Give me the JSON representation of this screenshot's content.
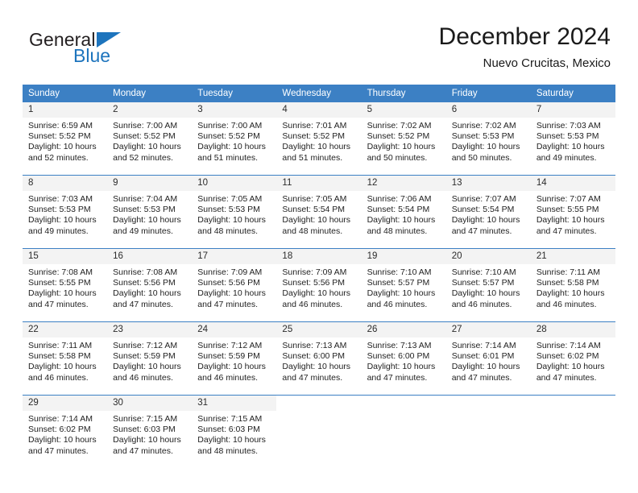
{
  "brand": {
    "line1": "General",
    "line2": "Blue",
    "triangle_color": "#1d74bd"
  },
  "header": {
    "title": "December 2024",
    "location": "Nuevo Crucitas, Mexico"
  },
  "theme": {
    "header_blue": "#3c80c4",
    "daynum_band": "#f3f3f3",
    "text": "#222222"
  },
  "weekday_headers": [
    "Sunday",
    "Monday",
    "Tuesday",
    "Wednesday",
    "Thursday",
    "Friday",
    "Saturday"
  ],
  "labels": {
    "sunrise_prefix": "Sunrise: ",
    "sunset_prefix": "Sunset: ",
    "daylight_prefix": "Daylight: "
  },
  "weeks": [
    [
      {
        "day": "1",
        "sunrise": "Sunrise: 6:59 AM",
        "sunset": "Sunset: 5:52 PM",
        "daylight1": "Daylight: 10 hours",
        "daylight2": "and 52 minutes."
      },
      {
        "day": "2",
        "sunrise": "Sunrise: 7:00 AM",
        "sunset": "Sunset: 5:52 PM",
        "daylight1": "Daylight: 10 hours",
        "daylight2": "and 52 minutes."
      },
      {
        "day": "3",
        "sunrise": "Sunrise: 7:00 AM",
        "sunset": "Sunset: 5:52 PM",
        "daylight1": "Daylight: 10 hours",
        "daylight2": "and 51 minutes."
      },
      {
        "day": "4",
        "sunrise": "Sunrise: 7:01 AM",
        "sunset": "Sunset: 5:52 PM",
        "daylight1": "Daylight: 10 hours",
        "daylight2": "and 51 minutes."
      },
      {
        "day": "5",
        "sunrise": "Sunrise: 7:02 AM",
        "sunset": "Sunset: 5:52 PM",
        "daylight1": "Daylight: 10 hours",
        "daylight2": "and 50 minutes."
      },
      {
        "day": "6",
        "sunrise": "Sunrise: 7:02 AM",
        "sunset": "Sunset: 5:53 PM",
        "daylight1": "Daylight: 10 hours",
        "daylight2": "and 50 minutes."
      },
      {
        "day": "7",
        "sunrise": "Sunrise: 7:03 AM",
        "sunset": "Sunset: 5:53 PM",
        "daylight1": "Daylight: 10 hours",
        "daylight2": "and 49 minutes."
      }
    ],
    [
      {
        "day": "8",
        "sunrise": "Sunrise: 7:03 AM",
        "sunset": "Sunset: 5:53 PM",
        "daylight1": "Daylight: 10 hours",
        "daylight2": "and 49 minutes."
      },
      {
        "day": "9",
        "sunrise": "Sunrise: 7:04 AM",
        "sunset": "Sunset: 5:53 PM",
        "daylight1": "Daylight: 10 hours",
        "daylight2": "and 49 minutes."
      },
      {
        "day": "10",
        "sunrise": "Sunrise: 7:05 AM",
        "sunset": "Sunset: 5:53 PM",
        "daylight1": "Daylight: 10 hours",
        "daylight2": "and 48 minutes."
      },
      {
        "day": "11",
        "sunrise": "Sunrise: 7:05 AM",
        "sunset": "Sunset: 5:54 PM",
        "daylight1": "Daylight: 10 hours",
        "daylight2": "and 48 minutes."
      },
      {
        "day": "12",
        "sunrise": "Sunrise: 7:06 AM",
        "sunset": "Sunset: 5:54 PM",
        "daylight1": "Daylight: 10 hours",
        "daylight2": "and 48 minutes."
      },
      {
        "day": "13",
        "sunrise": "Sunrise: 7:07 AM",
        "sunset": "Sunset: 5:54 PM",
        "daylight1": "Daylight: 10 hours",
        "daylight2": "and 47 minutes."
      },
      {
        "day": "14",
        "sunrise": "Sunrise: 7:07 AM",
        "sunset": "Sunset: 5:55 PM",
        "daylight1": "Daylight: 10 hours",
        "daylight2": "and 47 minutes."
      }
    ],
    [
      {
        "day": "15",
        "sunrise": "Sunrise: 7:08 AM",
        "sunset": "Sunset: 5:55 PM",
        "daylight1": "Daylight: 10 hours",
        "daylight2": "and 47 minutes."
      },
      {
        "day": "16",
        "sunrise": "Sunrise: 7:08 AM",
        "sunset": "Sunset: 5:56 PM",
        "daylight1": "Daylight: 10 hours",
        "daylight2": "and 47 minutes."
      },
      {
        "day": "17",
        "sunrise": "Sunrise: 7:09 AM",
        "sunset": "Sunset: 5:56 PM",
        "daylight1": "Daylight: 10 hours",
        "daylight2": "and 47 minutes."
      },
      {
        "day": "18",
        "sunrise": "Sunrise: 7:09 AM",
        "sunset": "Sunset: 5:56 PM",
        "daylight1": "Daylight: 10 hours",
        "daylight2": "and 46 minutes."
      },
      {
        "day": "19",
        "sunrise": "Sunrise: 7:10 AM",
        "sunset": "Sunset: 5:57 PM",
        "daylight1": "Daylight: 10 hours",
        "daylight2": "and 46 minutes."
      },
      {
        "day": "20",
        "sunrise": "Sunrise: 7:10 AM",
        "sunset": "Sunset: 5:57 PM",
        "daylight1": "Daylight: 10 hours",
        "daylight2": "and 46 minutes."
      },
      {
        "day": "21",
        "sunrise": "Sunrise: 7:11 AM",
        "sunset": "Sunset: 5:58 PM",
        "daylight1": "Daylight: 10 hours",
        "daylight2": "and 46 minutes."
      }
    ],
    [
      {
        "day": "22",
        "sunrise": "Sunrise: 7:11 AM",
        "sunset": "Sunset: 5:58 PM",
        "daylight1": "Daylight: 10 hours",
        "daylight2": "and 46 minutes."
      },
      {
        "day": "23",
        "sunrise": "Sunrise: 7:12 AM",
        "sunset": "Sunset: 5:59 PM",
        "daylight1": "Daylight: 10 hours",
        "daylight2": "and 46 minutes."
      },
      {
        "day": "24",
        "sunrise": "Sunrise: 7:12 AM",
        "sunset": "Sunset: 5:59 PM",
        "daylight1": "Daylight: 10 hours",
        "daylight2": "and 46 minutes."
      },
      {
        "day": "25",
        "sunrise": "Sunrise: 7:13 AM",
        "sunset": "Sunset: 6:00 PM",
        "daylight1": "Daylight: 10 hours",
        "daylight2": "and 47 minutes."
      },
      {
        "day": "26",
        "sunrise": "Sunrise: 7:13 AM",
        "sunset": "Sunset: 6:00 PM",
        "daylight1": "Daylight: 10 hours",
        "daylight2": "and 47 minutes."
      },
      {
        "day": "27",
        "sunrise": "Sunrise: 7:14 AM",
        "sunset": "Sunset: 6:01 PM",
        "daylight1": "Daylight: 10 hours",
        "daylight2": "and 47 minutes."
      },
      {
        "day": "28",
        "sunrise": "Sunrise: 7:14 AM",
        "sunset": "Sunset: 6:02 PM",
        "daylight1": "Daylight: 10 hours",
        "daylight2": "and 47 minutes."
      }
    ],
    [
      {
        "day": "29",
        "sunrise": "Sunrise: 7:14 AM",
        "sunset": "Sunset: 6:02 PM",
        "daylight1": "Daylight: 10 hours",
        "daylight2": "and 47 minutes."
      },
      {
        "day": "30",
        "sunrise": "Sunrise: 7:15 AM",
        "sunset": "Sunset: 6:03 PM",
        "daylight1": "Daylight: 10 hours",
        "daylight2": "and 47 minutes."
      },
      {
        "day": "31",
        "sunrise": "Sunrise: 7:15 AM",
        "sunset": "Sunset: 6:03 PM",
        "daylight1": "Daylight: 10 hours",
        "daylight2": "and 48 minutes."
      },
      {
        "day": "",
        "sunrise": "",
        "sunset": "",
        "daylight1": "",
        "daylight2": ""
      },
      {
        "day": "",
        "sunrise": "",
        "sunset": "",
        "daylight1": "",
        "daylight2": ""
      },
      {
        "day": "",
        "sunrise": "",
        "sunset": "",
        "daylight1": "",
        "daylight2": ""
      },
      {
        "day": "",
        "sunrise": "",
        "sunset": "",
        "daylight1": "",
        "daylight2": ""
      }
    ]
  ]
}
